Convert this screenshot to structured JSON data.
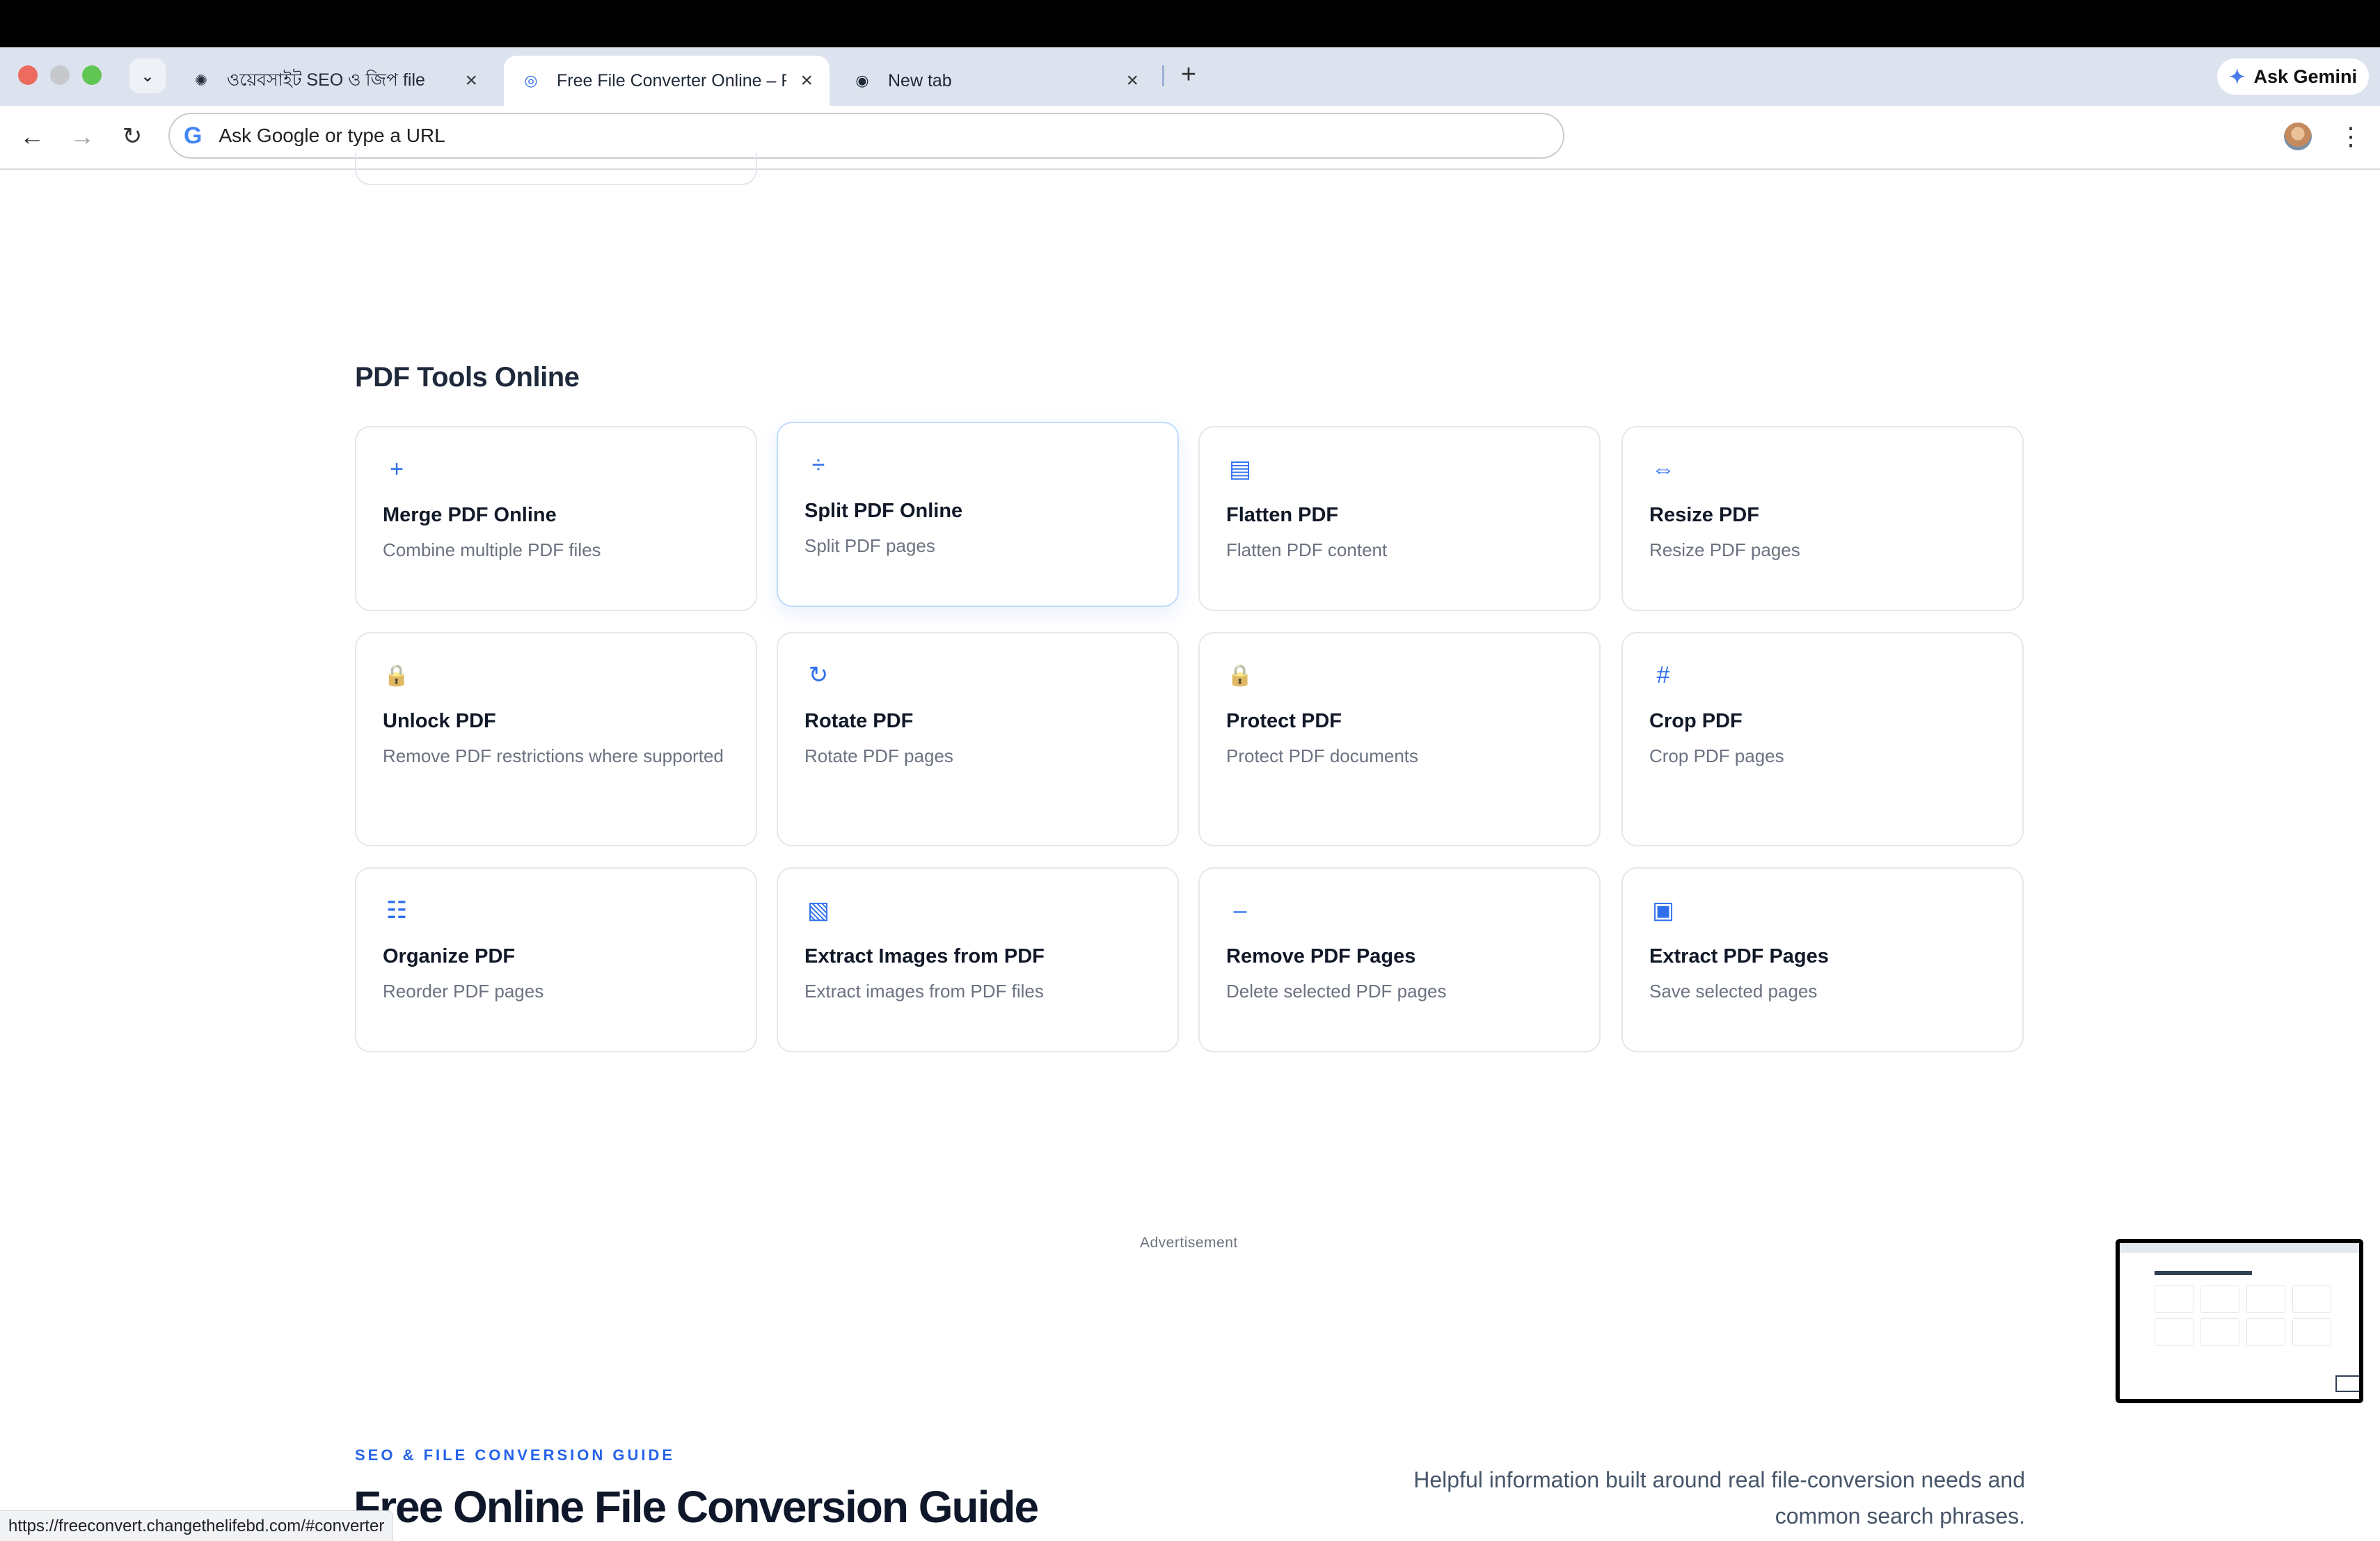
{
  "browser": {
    "tabs": [
      {
        "title": "ওয়েবসাইট SEO ও জিপ file",
        "active": false
      },
      {
        "title": "Free File Converter Online – F",
        "active": true
      },
      {
        "title": "New tab",
        "active": false
      }
    ],
    "gemini_label": "Ask Gemini",
    "omnibox_placeholder": "Ask Google or type a URL",
    "status_url": "https://freeconvert.changethelifebd.com/#converter"
  },
  "pdf_tools": {
    "heading": "PDF Tools Online",
    "cards": [
      {
        "icon": "plus-icon",
        "glyph": "+",
        "title": "Merge PDF Online",
        "desc": "Combine multiple PDF files"
      },
      {
        "icon": "divide-icon",
        "glyph": "÷",
        "title": "Split PDF Online",
        "desc": "Split PDF pages"
      },
      {
        "icon": "layers-icon",
        "glyph": "▤",
        "title": "Flatten PDF",
        "desc": "Flatten PDF content"
      },
      {
        "icon": "resize-arrows-icon",
        "glyph": "⇔",
        "title": "Resize PDF",
        "desc": "Resize PDF pages"
      },
      {
        "icon": "lock-icon",
        "glyph": "🔒",
        "title": "Unlock PDF",
        "desc": "Remove PDF restrictions where supported"
      },
      {
        "icon": "rotate-icon",
        "glyph": "↻",
        "title": "Rotate PDF",
        "desc": "Rotate PDF pages"
      },
      {
        "icon": "lock-icon",
        "glyph": "🔒",
        "title": "Protect PDF",
        "desc": "Protect PDF documents"
      },
      {
        "icon": "crop-hash-icon",
        "glyph": "#",
        "title": "Crop PDF",
        "desc": "Crop PDF pages"
      },
      {
        "icon": "list-icon",
        "glyph": "☷",
        "title": "Organize PDF",
        "desc": "Reorder PDF pages"
      },
      {
        "icon": "image-hatch-icon",
        "glyph": "▧",
        "title": "Extract Images from PDF",
        "desc": "Extract images from PDF files"
      },
      {
        "icon": "minus-icon",
        "glyph": "–",
        "title": "Remove PDF Pages",
        "desc": "Delete selected PDF pages"
      },
      {
        "icon": "square-icon",
        "glyph": "▣",
        "title": "Extract PDF Pages",
        "desc": "Save selected pages"
      }
    ]
  },
  "advertisement_label": "Advertisement",
  "guide": {
    "kicker": "SEO & FILE CONVERSION GUIDE",
    "title": "Free Online File Conversion Guide",
    "subtitle": "Helpful information built around real file-conversion needs and common search phrases."
  },
  "colors": {
    "accent": "#2563eb",
    "tabstrip": "#dde3ee",
    "card_border": "#e5e7eb"
  }
}
